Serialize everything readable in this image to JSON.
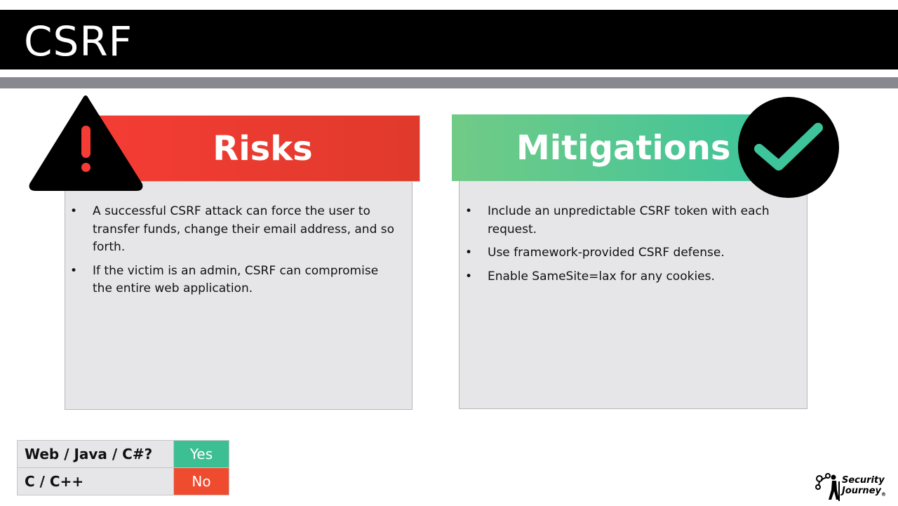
{
  "slide": {
    "title": "CSRF"
  },
  "risks": {
    "heading": "Risks",
    "items": [
      "A successful CSRF attack can force the user to transfer funds, change their email address, and so forth.",
      "If the victim is an admin, CSRF can compromise the entire web application."
    ],
    "icon": "warning-triangle-icon",
    "color": "#f43c34"
  },
  "mitigations": {
    "heading": "Mitigations",
    "items": [
      "Include an unpredictable CSRF token with each request.",
      "Use framework-provided CSRF defense.",
      "Enable SameSite=lax for any cookies."
    ],
    "icon": "checkmark-icon",
    "color": "#3ec49b"
  },
  "compat": {
    "rows": [
      {
        "label": "Web / Java / C#?",
        "value": "Yes",
        "color": "#3dbf94"
      },
      {
        "label": "C / C++",
        "value": "No",
        "color": "#ef4b2f"
      }
    ]
  },
  "logo": {
    "line1": "Security",
    "line2": "Journey",
    "mark": "®"
  }
}
